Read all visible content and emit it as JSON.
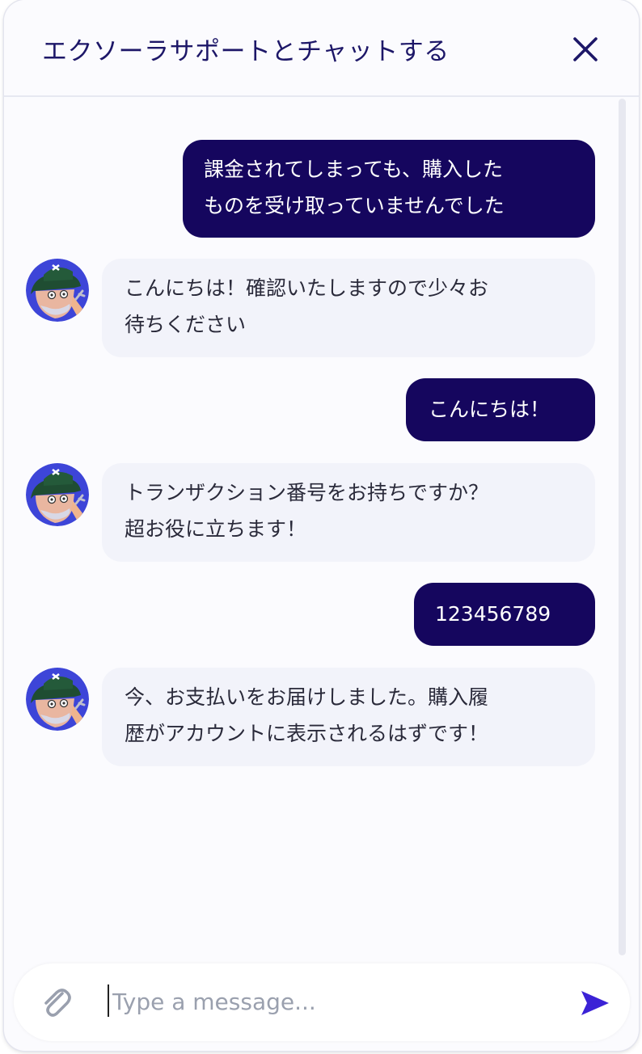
{
  "header": {
    "title": "エクソーラサポートとチャットする"
  },
  "messages": [
    {
      "sender": "user",
      "lines": [
        "課金されてしまっても、購入した",
        "ものを受け取っていませんでした"
      ]
    },
    {
      "sender": "bot",
      "lines": [
        "こんにちは！確認いたしますので少々お",
        "待ちください"
      ]
    },
    {
      "sender": "user",
      "lines": [
        "こんにちは！"
      ]
    },
    {
      "sender": "bot",
      "lines": [
        "トランザクション番号をお持ちですか？",
        "超お役に立ちます！"
      ]
    },
    {
      "sender": "user",
      "lines": [
        "123456789"
      ]
    },
    {
      "sender": "bot",
      "lines": [
        "今、お支払いをお届けしました。購入履",
        "歴がアカウントに表示されるはずです！"
      ]
    }
  ],
  "composer": {
    "placeholder": "Type a message..."
  },
  "icons": {
    "close": "close-icon",
    "attach": "paperclip-icon",
    "send": "send-icon",
    "avatar": "support-avatar"
  },
  "colors": {
    "accent": "#15065e",
    "title": "#1d1768",
    "send": "#3b22d6"
  }
}
